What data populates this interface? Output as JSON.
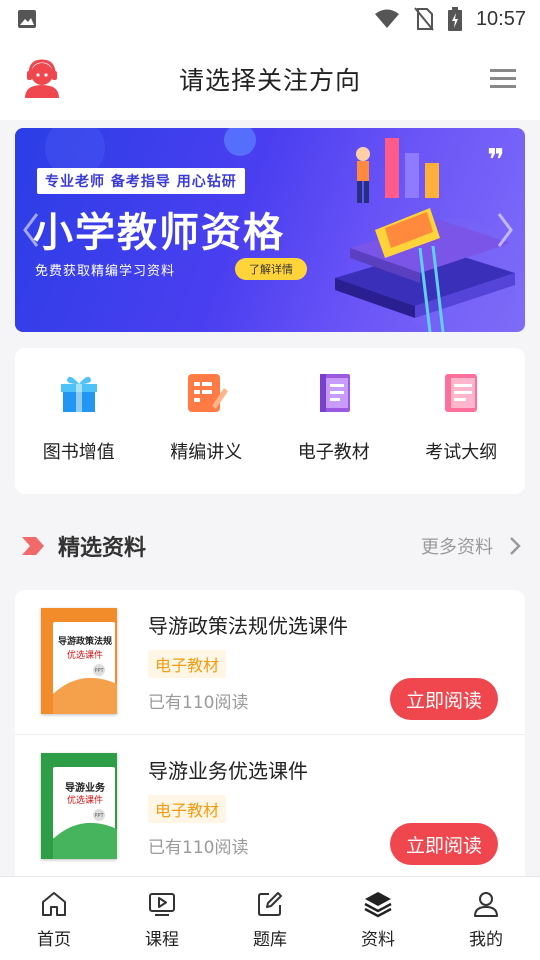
{
  "status_bar": {
    "time": "10:57",
    "icons": [
      "image-icon",
      "wifi-icon",
      "no-sim-icon",
      "battery-charging-icon"
    ]
  },
  "header": {
    "title": "请选择关注方向",
    "avatar_icon": "headset-avatar-icon",
    "menu_icon": "hamburger-menu-icon"
  },
  "banner": {
    "tag": "专业老师 备考指导 用心钻研",
    "title": "小学教师资格",
    "subtitle": "免费获取精编学习资料",
    "button": "了解详情"
  },
  "categories": [
    {
      "label": "图书增值",
      "icon": "gift-box-icon"
    },
    {
      "label": "精编讲义",
      "icon": "notebook-pen-icon"
    },
    {
      "label": "电子教材",
      "icon": "ebook-icon"
    },
    {
      "label": "考试大纲",
      "icon": "document-list-icon"
    }
  ],
  "section": {
    "title": "精选资料",
    "more": "更多资料"
  },
  "materials": [
    {
      "title": "导游政策法规优选课件",
      "tag": "电子教材",
      "reads": "已有110阅读",
      "button": "立即阅读",
      "cover_line1": "导游政策法规",
      "cover_line2": "优选课件",
      "cover_color": "#f28b2a"
    },
    {
      "title": "导游业务优选课件",
      "tag": "电子教材",
      "reads": "已有110阅读",
      "button": "立即阅读",
      "cover_line1": "导游业务",
      "cover_line2": "优选课件",
      "cover_color": "#2e9e46"
    }
  ],
  "bottom_nav": [
    {
      "label": "首页",
      "icon": "home-icon"
    },
    {
      "label": "课程",
      "icon": "video-play-icon"
    },
    {
      "label": "题库",
      "icon": "edit-icon"
    },
    {
      "label": "资料",
      "icon": "layers-icon"
    },
    {
      "label": "我的",
      "icon": "user-icon"
    }
  ],
  "colors": {
    "accent_red": "#f0474f",
    "tag_orange": "#f39c12",
    "banner_blue": "#3a3fe8"
  }
}
